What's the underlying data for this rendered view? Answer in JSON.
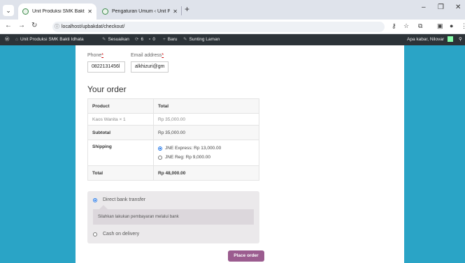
{
  "browser": {
    "tabs": [
      {
        "title": "Unit Produksi SMK Bakti Idhata",
        "close": "✕"
      },
      {
        "title": "Pengaturan Umum ‹ Unit Produ",
        "close": "✕"
      }
    ],
    "url": "localhost/upbakdat/checkout/"
  },
  "adminbar": {
    "site_name": "Unit Produksi SMK Bakti Idhata",
    "customize": "Sesuaikan",
    "updates": "6",
    "comments": "0",
    "new": "Baru",
    "edit": "Sunting Laman",
    "greeting": "Apa kabar, Nilovar"
  },
  "billing": {
    "phone_label": "Phone",
    "phone_value": "0822131456l",
    "email_label": "Email address",
    "email_value": "alkhizuri@gm",
    "required_mark": "*"
  },
  "order": {
    "title": "Your order",
    "col_product": "Product",
    "col_total": "Total",
    "item_name": "Kaos Wanita",
    "item_qty": "× 1",
    "item_total": "Rp 35,000.00",
    "subtotal_label": "Subtotal",
    "subtotal_value": "Rp 35,000.00",
    "shipping_label": "Shipping",
    "shipping_options": [
      {
        "label": "JNE Express: Rp 13,000.00",
        "selected": true
      },
      {
        "label": "JNE Reg: Rp 9,000.00",
        "selected": false
      }
    ],
    "total_label": "Total",
    "total_value": "Rp 48,000.00"
  },
  "payment": {
    "options": [
      {
        "label": "Direct bank transfer",
        "selected": true
      },
      {
        "label": "Cash on delivery",
        "selected": false
      }
    ],
    "description": "Silahkan lakukan pembayaran melalui bank",
    "place_order": "Place order"
  },
  "colors": {
    "page_bg": "#2aa4c6",
    "button": "#9b5c8f",
    "adminbar": "#2c3338"
  }
}
